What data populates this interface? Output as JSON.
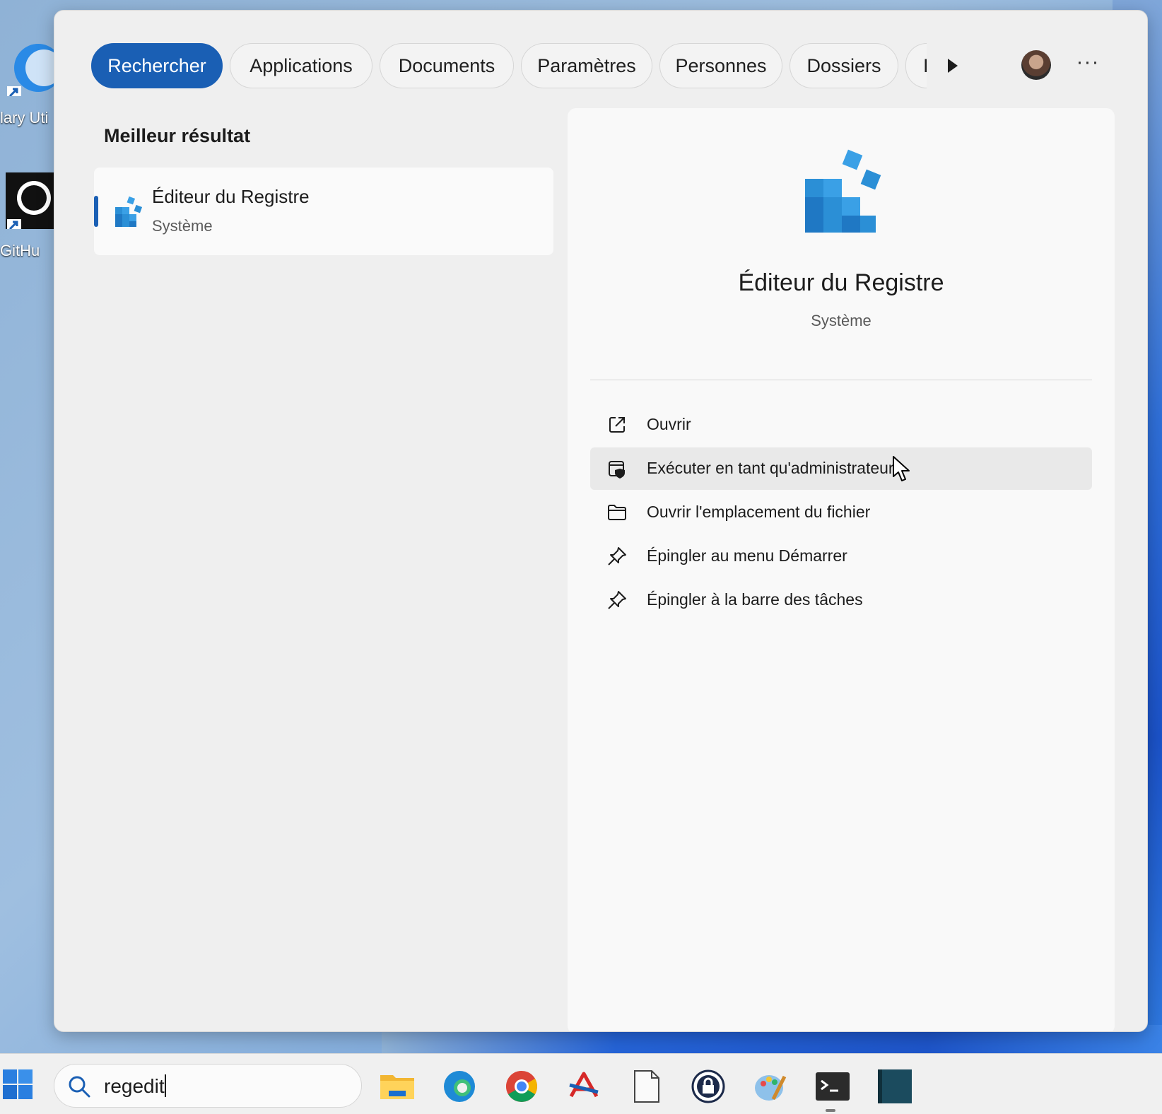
{
  "desktop": {
    "icons": [
      {
        "label": "lary Uti",
        "icon": "glary-utilities-icon"
      },
      {
        "label": "GitHu",
        "icon": "github-icon"
      }
    ]
  },
  "start": {
    "tabs": [
      {
        "label": "Rechercher",
        "active": true
      },
      {
        "label": "Applications"
      },
      {
        "label": "Documents"
      },
      {
        "label": "Paramètres"
      },
      {
        "label": "Personnes"
      },
      {
        "label": "Dossiers"
      },
      {
        "label": "I"
      }
    ],
    "more_label": "···",
    "best_match": {
      "heading": "Meilleur résultat",
      "name": "Éditeur du Registre",
      "type": "Système"
    },
    "detail": {
      "title": "Éditeur du Registre",
      "subtitle": "Système",
      "actions": [
        {
          "label": "Ouvrir",
          "icon": "open-external-icon"
        },
        {
          "label": "Exécuter en tant qu'administrateur",
          "icon": "admin-shield-icon",
          "hovered": true
        },
        {
          "label": "Ouvrir l'emplacement du fichier",
          "icon": "folder-icon"
        },
        {
          "label": "Épingler au menu Démarrer",
          "icon": "pin-icon"
        },
        {
          "label": "Épingler à la barre des tâches",
          "icon": "pin-icon"
        }
      ]
    }
  },
  "taskbar": {
    "search_value": "regedit",
    "apps": [
      "file-explorer-icon",
      "edge-icon",
      "chrome-icon",
      "acrobat-icon",
      "notepad-icon",
      "password-manager-icon",
      "paint-icon",
      "terminal-icon",
      "teal-app-icon"
    ]
  },
  "colors": {
    "accent": "#1a5fb4",
    "panel": "#efefef",
    "detail": "#f9f9f9"
  }
}
